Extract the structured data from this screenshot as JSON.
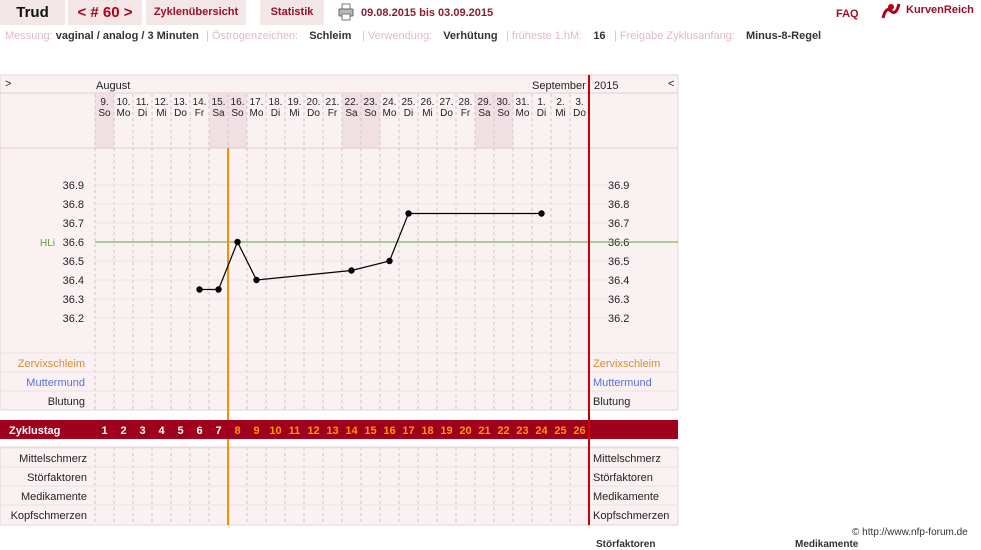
{
  "header": {
    "name": "Trud",
    "cycle_nav": "< # 60 >",
    "tabs": [
      "Zyklenübersicht",
      "Statistik"
    ],
    "date_range": "09.08.2015 bis 03.09.2015",
    "faq": "FAQ",
    "logo_text": "KurvenReich",
    "print_icon": "printer-icon",
    "logo_icon": "kurvenreich-logo-icon"
  },
  "meta": [
    {
      "label": "Messung:",
      "value": "vaginal / analog / 3 Minuten"
    },
    {
      "label": "Östrogenzeichen:",
      "value": "Schleim"
    },
    {
      "label": "Verwendung:",
      "value": "Verhütung"
    },
    {
      "label": "früheste 1.hM:",
      "value": "16"
    },
    {
      "label": "Freigabe Zyklusanfang:",
      "value": "Minus-8-Regel"
    }
  ],
  "footer": {
    "copyright": "© http://www.nfp-forum.de",
    "cut_labels": [
      "Störfaktoren",
      "Medikamente"
    ]
  },
  "colors": {
    "accent": "#a0001c",
    "coverline": "#6b9a3a",
    "ovulation_line": "#ff8c00",
    "end_line": "#cc0000",
    "weekend": "#f0e0e4",
    "panel_bg": "#faf2f2"
  },
  "chart_data": {
    "type": "line",
    "nav_left": ">",
    "nav_right": "<",
    "month_left": "August",
    "month_right": "September",
    "year": "2015",
    "dates": [
      "9.",
      "10.",
      "11.",
      "12.",
      "13.",
      "14.",
      "15.",
      "16.",
      "17.",
      "18.",
      "19.",
      "20.",
      "21.",
      "22.",
      "23.",
      "24.",
      "25.",
      "26.",
      "27.",
      "28.",
      "29.",
      "30.",
      "31.",
      "1.",
      "2.",
      "3."
    ],
    "weekdays": [
      "So",
      "Mo",
      "Di",
      "Mi",
      "Do",
      "Fr",
      "Sa",
      "So",
      "Mo",
      "Di",
      "Mi",
      "Do",
      "Fr",
      "Sa",
      "So",
      "Mo",
      "Di",
      "Mi",
      "Do",
      "Fr",
      "Sa",
      "So",
      "Mo",
      "Di",
      "Mi",
      "Do"
    ],
    "weekend_days": [
      1,
      7,
      8,
      14,
      15,
      21,
      22
    ],
    "cycle_label": "Zyklustag",
    "cycle_days": [
      1,
      2,
      3,
      4,
      5,
      6,
      7,
      8,
      9,
      10,
      11,
      12,
      13,
      14,
      15,
      16,
      17,
      18,
      19,
      20,
      21,
      22,
      23,
      24,
      25,
      26
    ],
    "y_ticks": [
      "36.9",
      "36.8",
      "36.7",
      "36.6",
      "36.5",
      "36.4",
      "36.3",
      "36.2"
    ],
    "ylim": [
      36.2,
      36.9
    ],
    "coverline_label": "HLi",
    "coverline_value": 36.6,
    "ovulation_after_day": 7,
    "series": [
      {
        "values": [
          {
            "day": 6,
            "temp": 36.35
          },
          {
            "day": 7,
            "temp": 36.35
          },
          {
            "day": 8,
            "temp": 36.6
          },
          {
            "day": 9,
            "temp": 36.4
          },
          {
            "day": 14,
            "temp": 36.45
          },
          {
            "day": 16,
            "temp": 36.5
          },
          {
            "day": 17,
            "temp": 36.75
          },
          {
            "day": 24,
            "temp": 36.75
          }
        ]
      }
    ],
    "sign_rows_top": [
      {
        "label": "Zervixschleim",
        "color": "#e08a2c"
      },
      {
        "label": "Muttermund",
        "color": "#5a6fd6"
      },
      {
        "label": "Blutung",
        "color": "#222222"
      }
    ],
    "sign_rows_bottom": [
      "Mittelschmerz",
      "Störfaktoren",
      "Medikamente",
      "Kopfschmerzen"
    ]
  }
}
